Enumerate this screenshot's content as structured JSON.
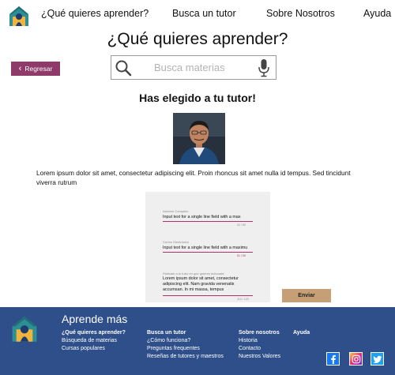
{
  "nav": {
    "items": [
      {
        "label": "¿Qué quieres aprender?"
      },
      {
        "label": "Busca un tutor"
      },
      {
        "label": "Sobre Nosotros"
      },
      {
        "label": "Ayuda"
      }
    ]
  },
  "page": {
    "title": "¿Qué quieres aprender?",
    "back_label": "Regresar",
    "search_placeholder": "Busca materias",
    "chosen_title": "Has elegido a tu tutor!",
    "description": "Lorem ipsum dolor sit amet, consectetur adipiscing elit. Proin rhoncus sit amet nulla id tempus. Sed tincidunt viverra rutrum"
  },
  "form": {
    "fields": [
      {
        "label": "Nombre Completo",
        "value": "Input text for a single line field with a max",
        "count": "31 / 50"
      },
      {
        "label": "Correo Electrónico",
        "value": "Input text for a single line field with a maximu",
        "count": "51 / 50"
      },
      {
        "label": "Platícale a tu tutor en que quieres enfocarte",
        "value": "Lorem ipsum dolor sit amet, consectetur adipiscing elit. Nam gravida venenatis accumsan. In mi massa, tempus",
        "count": "110 / 120"
      }
    ],
    "submit_label": "Enviar"
  },
  "footer": {
    "title": "Aprende más",
    "columns": [
      {
        "heading": "¿Qué quieres aprender?",
        "links": [
          "Búsqueda de materias",
          "Cursas populares"
        ]
      },
      {
        "heading": "Busca un tutor",
        "links": [
          "¿Cómo funciona?",
          "Preguntas frequentes",
          "Reseñas de tutores y maestros"
        ]
      },
      {
        "heading": "Sobre nosotros",
        "links": [
          "Historia",
          "Contacto",
          "Nuestros Valores"
        ]
      },
      {
        "heading": "Ayuda",
        "links": []
      }
    ]
  },
  "social": [
    {
      "icon": "facebook-icon"
    },
    {
      "icon": "instagram-icon"
    },
    {
      "icon": "twitter-icon"
    }
  ],
  "colors": {
    "back_button": "#8e3b6a",
    "send_button": "#c79f76",
    "footer_bg": "#2e4f89",
    "field_underline": "#b03070",
    "logo_teal": "#2c8f96",
    "logo_yellow": "#f0b43c"
  }
}
